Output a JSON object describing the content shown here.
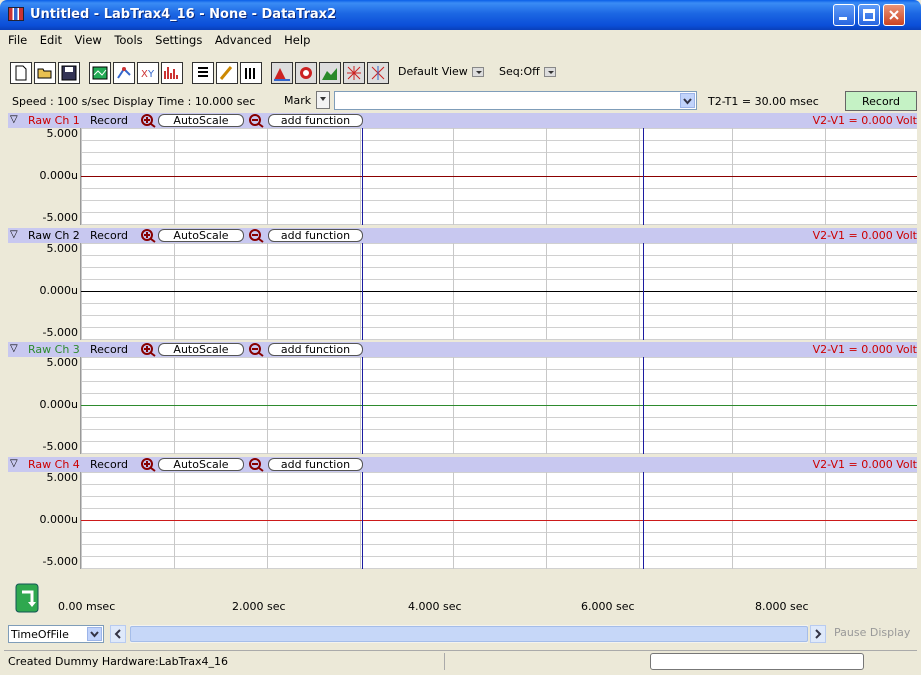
{
  "window": {
    "title": "Untitled - LabTrax4_16 - None - DataTrax2"
  },
  "menu": [
    "File",
    "Edit",
    "View",
    "Tools",
    "Settings",
    "Advanced",
    "Help"
  ],
  "toolbar": {
    "icons": [
      "new-file-icon",
      "open-folder-icon",
      "save-icon",
      "scope-icon",
      "xy-plot-icon",
      "xy-scatter-icon",
      "fft-icon",
      "list-icon",
      "pen-icon",
      "histogram-icon",
      "mountain-icon",
      "zoom-target-icon",
      "area-chart-icon",
      "grid-icon",
      "wave-icon"
    ],
    "view_label": "Default View",
    "seq_label": "Seq:Off"
  },
  "status": {
    "speed_text": "Speed : 100 s/sec  Display Time : 10.000 sec",
    "mark_label": "Mark",
    "t2t1": "T2-T1 = 30.00 msec",
    "record_label": "Record"
  },
  "channels": [
    {
      "name": "Raw Ch 1",
      "record": "Record",
      "autoscale": "AutoScale",
      "add_function": "add function",
      "volt": "V2-V1 = 0.000 Volt",
      "y_top": "5.000",
      "y_mid": "0.000u",
      "y_bot": "-5.000",
      "color": "#8b0000",
      "name_color": "#cc0000"
    },
    {
      "name": "Raw Ch 2",
      "record": "Record",
      "autoscale": "AutoScale",
      "add_function": "add function",
      "volt": "V2-V1 = 0.000 Volt",
      "y_top": "5.000",
      "y_mid": "0.000u",
      "y_bot": "-5.000",
      "color": "#000000",
      "name_color": "#000000"
    },
    {
      "name": "Raw Ch 3",
      "record": "Record",
      "autoscale": "AutoScale",
      "add_function": "add function",
      "volt": "V2-V1 = 0.000 Volt",
      "y_top": "5.000",
      "y_mid": "0.000u",
      "y_bot": "-5.000",
      "color": "#2e8b2e",
      "name_color": "#2e8b2e"
    },
    {
      "name": "Raw Ch 4",
      "record": "Record",
      "autoscale": "AutoScale",
      "add_function": "add function",
      "volt": "V2-V1 = 0.000 Volt",
      "y_top": "5.000",
      "y_mid": "0.000u",
      "y_bot": "-5.000",
      "color": "#cc1a1a",
      "name_color": "#cc0000"
    }
  ],
  "time_axis": [
    "0.00 msec",
    "2.000 sec",
    "4.000 sec",
    "6.000 sec",
    "8.000 sec"
  ],
  "bottom": {
    "timeof_label": "TimeOfFile",
    "pause_label": "Pause Display"
  },
  "statusbar": {
    "message": "Created Dummy Hardware:LabTrax4_16"
  },
  "colors": {
    "header_bg": "#c8c8f0",
    "cursor": "#1c1ca0",
    "volt_text": "#cc0000",
    "record_btn": "#c5f2c5"
  }
}
